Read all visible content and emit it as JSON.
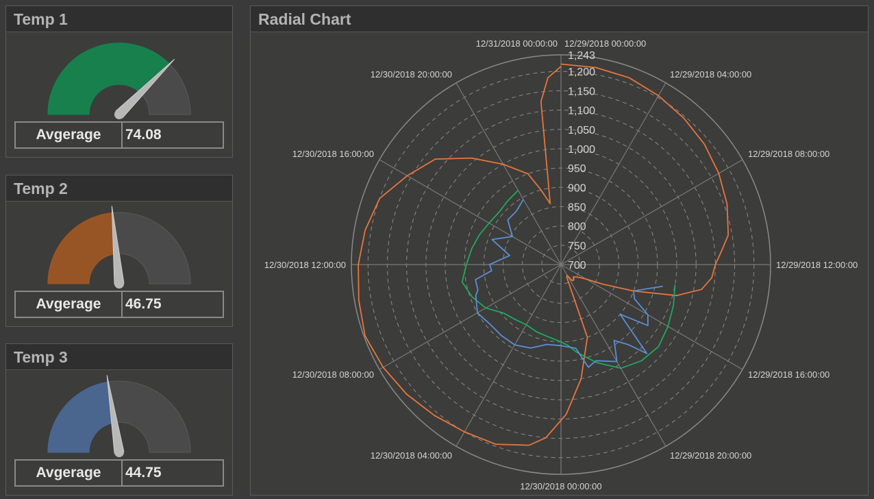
{
  "gauges": [
    {
      "title": "Temp 1",
      "label": "Avgerage",
      "value": "74.08",
      "fraction": 0.75,
      "color": "#0e8a4c"
    },
    {
      "title": "Temp 2",
      "label": "Avgerage",
      "value": "46.75",
      "fraction": 0.47,
      "color": "#a5571f"
    },
    {
      "title": "Temp 3",
      "label": "Avgerage",
      "value": "44.75",
      "fraction": 0.45,
      "color": "#4a6a9a"
    }
  ],
  "radial": {
    "title": "Radial Chart"
  },
  "chart_data": {
    "type": "radial-line",
    "title": "Radial Chart",
    "r_ticks": [
      "700",
      "750",
      "800",
      "850",
      "900",
      "950",
      "1,000",
      "1,050",
      "1,100",
      "1,150",
      "1,200",
      "1,243"
    ],
    "r_min": 700,
    "r_max": 1243,
    "angle_labels": [
      "12/29/2018 00:00:00",
      "12/29/2018 04:00:00",
      "12/29/2018 08:00:00",
      "12/29/2018 12:00:00",
      "12/29/2018 16:00:00",
      "12/29/2018 20:00:00",
      "12/30/2018 00:00:00",
      "12/30/2018 04:00:00",
      "12/30/2018 08:00:00",
      "12/30/2018 12:00:00",
      "12/30/2018 16:00:00",
      "12/30/2018 20:00:00",
      "12/31/2018 00:00:00"
    ],
    "grid": true,
    "series": [
      {
        "color": "#e8763a",
        "points": [
          [
            0,
            1219
          ],
          [
            1,
            1218
          ],
          [
            2,
            1215
          ],
          [
            3,
            1205
          ],
          [
            4,
            1195
          ],
          [
            5,
            1185
          ],
          [
            6,
            1172
          ],
          [
            7,
            1158
          ],
          [
            8,
            1140
          ],
          [
            8.5,
            1118
          ],
          [
            9,
            1100
          ],
          [
            9.5,
            1092
          ],
          [
            10,
            1070
          ],
          [
            10.5,
            1010
          ],
          [
            11,
            900
          ],
          [
            11.5,
            820
          ],
          [
            12,
            775
          ],
          [
            12.5,
            758
          ],
          [
            13,
            750
          ],
          [
            13.5,
            745
          ],
          [
            14,
            752
          ],
          [
            14.5,
            751
          ],
          [
            15,
            732
          ],
          [
            15.5,
            735
          ],
          [
            16,
            900
          ],
          [
            17,
            1000
          ],
          [
            17.8,
            1088
          ],
          [
            18.5,
            1150
          ],
          [
            19,
            1175
          ],
          [
            20,
            1195
          ],
          [
            21,
            1200
          ],
          [
            22,
            1210
          ],
          [
            23,
            1222
          ],
          [
            24,
            1232
          ],
          [
            25,
            1240
          ],
          [
            26,
            1232
          ],
          [
            27,
            1225
          ],
          [
            28,
            1215
          ],
          [
            29,
            1200
          ],
          [
            30,
            1160
          ],
          [
            31,
            1125
          ],
          [
            32,
            1060
          ],
          [
            33,
            1000
          ],
          [
            34,
            950
          ],
          [
            34.5,
            900
          ],
          [
            35,
            860
          ],
          [
            35.3,
            1125
          ],
          [
            35.6,
            1185
          ],
          [
            36,
            1213
          ]
        ]
      },
      {
        "color": "#1faa5b",
        "points": [
          [
            10,
            1000
          ],
          [
            11,
            1010
          ],
          [
            12,
            1020
          ],
          [
            13,
            1030
          ],
          [
            14,
            1025
          ],
          [
            15,
            1010
          ],
          [
            16,
            970
          ],
          [
            17,
            930
          ],
          [
            17.5,
            910
          ],
          [
            18,
            900
          ],
          [
            19,
            890
          ],
          [
            20,
            885
          ],
          [
            21,
            880
          ],
          [
            22,
            885
          ],
          [
            23,
            895
          ],
          [
            24,
            925
          ],
          [
            25,
            945
          ],
          [
            26,
            960
          ],
          [
            27,
            945
          ],
          [
            28,
            935
          ],
          [
            29,
            925
          ],
          [
            30,
            915
          ],
          [
            31,
            910
          ],
          [
            32,
            915
          ],
          [
            33,
            922
          ]
        ]
      },
      {
        "color": "#5b8fd6",
        "points": [
          [
            10.2,
            970
          ],
          [
            11,
            900
          ],
          [
            11.5,
            910
          ],
          [
            12,
            960
          ],
          [
            12.5,
            975
          ],
          [
            13,
            900
          ],
          [
            13.6,
            1020
          ],
          [
            14,
            970
          ],
          [
            14.5,
            940
          ],
          [
            15,
            990
          ],
          [
            16,
            965
          ],
          [
            16.5,
            975
          ],
          [
            17,
            920
          ],
          [
            18,
            910
          ],
          [
            19,
            910
          ],
          [
            20,
            930
          ],
          [
            21,
            940
          ],
          [
            22,
            940
          ],
          [
            23,
            940
          ],
          [
            24,
            950
          ],
          [
            25,
            935
          ],
          [
            25.3,
            925
          ],
          [
            26,
            925
          ],
          [
            26.5,
            880
          ],
          [
            27,
            885
          ],
          [
            28,
            835
          ],
          [
            29,
            890
          ],
          [
            30,
            845
          ],
          [
            31,
            880
          ],
          [
            32,
            880
          ],
          [
            33,
            895
          ]
        ]
      }
    ]
  }
}
